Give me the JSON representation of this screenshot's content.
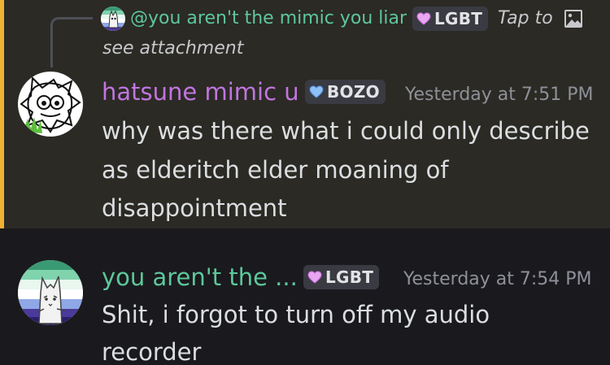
{
  "reply": {
    "author": "@you aren't the mimic you liar",
    "tag_label": "LGBT",
    "text_start": "Tap to",
    "text_end": "see attachment",
    "icon": "image-icon"
  },
  "messages": [
    {
      "author": "hatsune mimic u",
      "author_color": "#c175e0",
      "tag_label": "BOZO",
      "tag_icon": "blue-heart-icon",
      "timestamp": "Yesterday at 7:51 PM",
      "lines": [
        "why was there what i could only describe",
        "as elderitch elder moaning of",
        "disappointment"
      ],
      "highlighted": true
    },
    {
      "author": "you aren't the ...",
      "author_color": "#5ec79b",
      "tag_label": "LGBT",
      "tag_icon": "pink-heart-icon",
      "timestamp": "Yesterday at 7:54 PM",
      "lines": [
        "Shit, i forgot to turn off my audio",
        "recorder"
      ],
      "highlighted": false
    }
  ],
  "colors": {
    "highlight_bar": "#f0b232",
    "highlight_bg": "#2b2a24",
    "bg": "#1a1a1e",
    "tag_bg": "#3a3b42"
  }
}
